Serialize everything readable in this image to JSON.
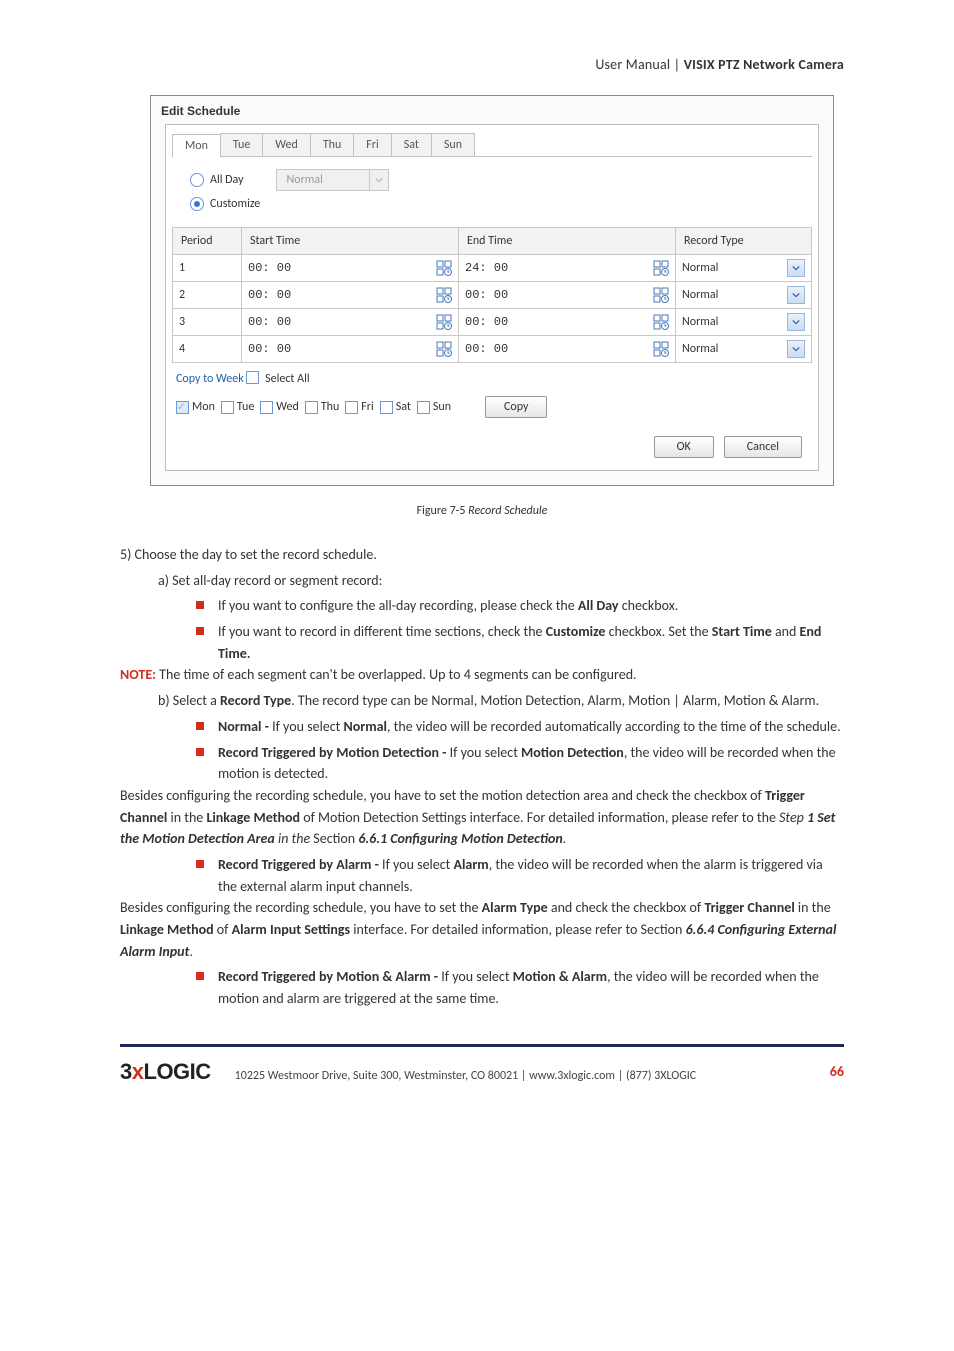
{
  "header": {
    "thin": "User Manual ",
    "pipe": "| ",
    "bold": "VISIX PTZ Network Camera"
  },
  "dialog": {
    "title": "Edit Schedule",
    "tabs": [
      "Mon",
      "Tue",
      "Wed",
      "Thu",
      "Fri",
      "Sat",
      "Sun"
    ],
    "active_tab": 0,
    "allday_label": "All Day",
    "allday_select": "Normal",
    "customize_label": "Customize",
    "headers": {
      "period": "Period",
      "start": "Start Time",
      "end": "End Time",
      "rtype": "Record Type"
    },
    "rows": [
      {
        "period": "1",
        "start": "00: 00",
        "end": "24: 00",
        "rtype": "Normal"
      },
      {
        "period": "2",
        "start": "00: 00",
        "end": "00: 00",
        "rtype": "Normal"
      },
      {
        "period": "3",
        "start": "00: 00",
        "end": "00: 00",
        "rtype": "Normal"
      },
      {
        "period": "4",
        "start": "00: 00",
        "end": "00: 00",
        "rtype": "Normal"
      }
    ],
    "copy_week": "Copy to Week",
    "select_all": "Select All",
    "copy_days": [
      "Mon",
      "Tue",
      "Wed",
      "Thu",
      "Fri",
      "Sat",
      "Sun"
    ],
    "copy_btn": "Copy",
    "ok_btn": "OK",
    "cancel_btn": "Cancel"
  },
  "figure": {
    "no": "Figure 7-5",
    "title": " Record Schedule"
  },
  "text": {
    "step5": "5)    Choose the day to set the record schedule.",
    "a": "a)    Set all-day record or segment record:",
    "a_b1_pre": "If you want to configure the all-day recording, please check the ",
    "a_b1_bold": "All Day",
    "a_b1_post": " checkbox.",
    "a_b2_pre": "If you want to record in different time sections, check the ",
    "a_b2_bold": "Customize",
    "a_b2_post": " checkbox. Set the ",
    "a_b2_bold2": "Start Time",
    "a_b2_mid": " and ",
    "a_b2_bold3": "End Time.",
    "note_label": "NOTE:",
    "note_body": " The time of each segment can't be overlapped. Up to 4 segments can be configured.",
    "b_pre": "b)    Select a ",
    "b_bold": "Record Type",
    "b_post": ". The record type can be Normal, Motion Detection, Alarm, Motion | Alarm, Motion & Alarm.",
    "b_b1_bold": "Normal - ",
    "b_b1_mid": "If you select ",
    "b_b1_bold2": "Normal",
    "b_b1_post": ", the video will be recorded automatically according to the time of the schedule.",
    "b_b2_bold": "Record Triggered by Motion Detection - ",
    "b_b2_mid": "If you select ",
    "b_b2_bold2": "Motion Detection",
    "b_b2_post": ", the video will be recorded when the motion is detected.",
    "b_b2_para_pre": "Besides configuring the recording schedule, you have to set the motion detection area and check the checkbox of ",
    "b_b2_para_b1": "Trigger Channel",
    "b_b2_para_mid1": " in the ",
    "b_b2_para_b2": "Linkage Method",
    "b_b2_para_mid2": " of Motion Detection Settings interface. For detailed information, please refer to the ",
    "b_b2_para_it1": "Step ",
    "b_b2_para_bit": "1 Set the Motion Detection Area",
    "b_b2_para_it2": " in the ",
    "b_b2_para_sec": "Section ",
    "b_b2_para_bit2": "6.6.1 Configuring Motion Detection",
    "b_b2_para_dot": ".",
    "b_b3_bold": "Record Triggered by Alarm - ",
    "b_b3_mid": "If you select ",
    "b_b3_bold2": "Alarm",
    "b_b3_post": ", the video will be recorded when the alarm is triggered via the external alarm input channels.",
    "b_b3_para_pre": "Besides configuring the recording schedule, you have to set the ",
    "b_b3_para_b1": "Alarm Type",
    "b_b3_para_mid1": " and check the checkbox of ",
    "b_b3_para_b2": "Trigger Channel",
    "b_b3_para_mid2": " in the ",
    "b_b3_para_b3": "Linkage Method",
    "b_b3_para_mid3": " of ",
    "b_b3_para_b4": "Alarm Input Settings",
    "b_b3_para_mid4": " interface. For detailed information, please refer to Section ",
    "b_b3_para_bit": "6.6.4 Configuring External Alarm Input",
    "b_b3_para_dot": ".",
    "b_b4_bold": "Record Triggered by Motion & Alarm - ",
    "b_b4_mid": "If you select ",
    "b_b4_bold2": "Motion & Alarm",
    "b_b4_post": ", the video will be recorded when the motion and alarm are triggered at the same time."
  },
  "footer": {
    "brand_pre": "3",
    "brand_x": "x",
    "brand_post": "LOGIC",
    "address": "10225 Westmoor Drive, Suite 300, Westminster, CO 80021 | www.3xlogic.com | (877) 3XLOGIC",
    "page": "66"
  }
}
